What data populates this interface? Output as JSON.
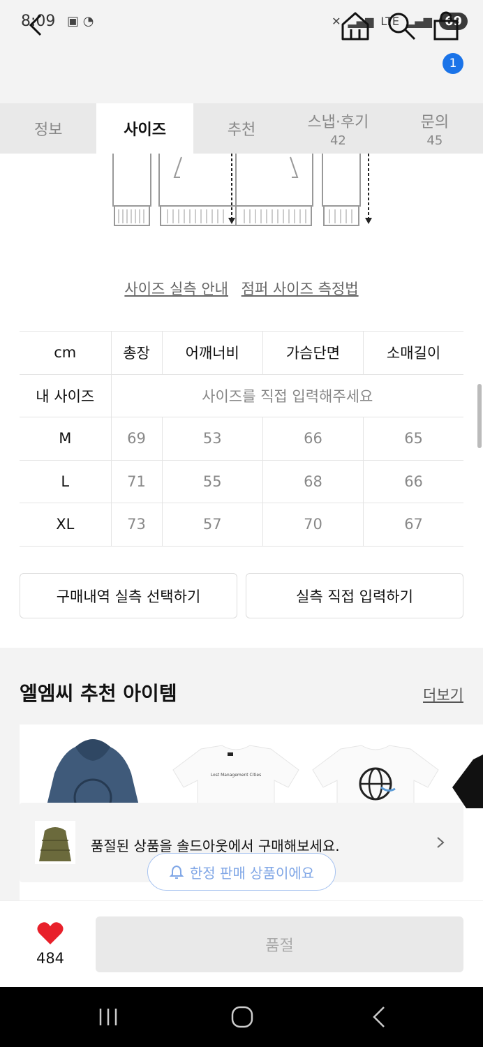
{
  "status": {
    "time": "8:09",
    "network": "LTE",
    "battery": "69"
  },
  "cart": {
    "badge": "1"
  },
  "tabs": [
    {
      "label": "정보",
      "count": ""
    },
    {
      "label": "사이즈",
      "count": ""
    },
    {
      "label": "추천",
      "count": ""
    },
    {
      "label": "스냅·후기",
      "count": "42"
    },
    {
      "label": "문의",
      "count": "45"
    }
  ],
  "links": {
    "guide": "사이즈 실측 안내",
    "measure": "점퍼 사이즈 측정법"
  },
  "size_table": {
    "headers": [
      "cm",
      "총장",
      "어깨너비",
      "가슴단면",
      "소매길이"
    ],
    "my_size_label": "내 사이즈",
    "my_size_placeholder": "사이즈를 직접 입력해주세요",
    "rows": [
      {
        "size": "M",
        "values": [
          "69",
          "53",
          "66",
          "65"
        ]
      },
      {
        "size": "L",
        "values": [
          "71",
          "55",
          "68",
          "66"
        ]
      },
      {
        "size": "XL",
        "values": [
          "73",
          "57",
          "70",
          "67"
        ]
      }
    ]
  },
  "buttons": {
    "select_history": "구매내역 실측 선택하기",
    "direct_input": "실측 직접 입력하기"
  },
  "recommend": {
    "title": "엘엠씨 추천 아이템",
    "more": "더보기",
    "tshirt_print": "Lost Management Cities"
  },
  "soldout_banner": {
    "message": "품절된 상품을 솔드아웃에서 구매해보세요."
  },
  "limited": {
    "label": "한정 판매 상품이에요"
  },
  "bottom": {
    "likes": "484",
    "soldout_label": "품절"
  },
  "colors": {
    "accent": "#1a73e8",
    "heart": "#e8202a",
    "pill_border": "#a7c3f0"
  }
}
